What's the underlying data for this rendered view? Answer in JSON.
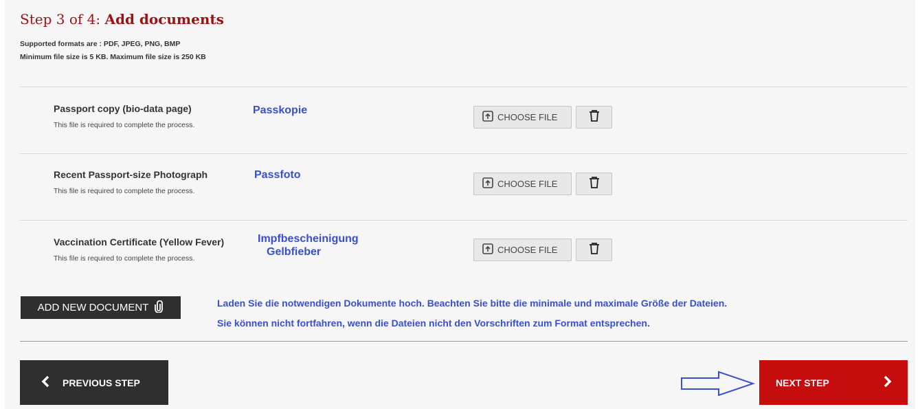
{
  "header": {
    "step_prefix": "Step 3 of 4: ",
    "step_title": "Add documents",
    "formats_note": "Supported formats are : PDF, JPEG, PNG, BMP",
    "size_note": "Minimum file size is 5 KB. Maximum file size is 250 KB"
  },
  "documents": [
    {
      "name": "Passport copy (bio-data page)",
      "note": "This file is required to complete the process.",
      "annotation_line1": "Passkopie",
      "annotation_line2": "",
      "choose_label": "CHOOSE FILE"
    },
    {
      "name": "Recent Passport-size Photograph",
      "note": "This file is required to complete the process.",
      "annotation_line1": "Passfoto",
      "annotation_line2": "",
      "choose_label": "CHOOSE FILE"
    },
    {
      "name": "Vaccination Certificate (Yellow Fever)",
      "note": "This file is required to complete the process.",
      "annotation_line1": "Impfbescheinigung",
      "annotation_line2": "Gelbfieber",
      "choose_label": "CHOOSE FILE"
    }
  ],
  "add_document_label": "ADD NEW DOCUMENT",
  "info": {
    "line1": "Laden Sie die notwendigen Dokumente hoch. Beachten Sie bitte die minimale und maximale Größe der Dateien.",
    "line2": "Sie können nicht fortfahren, wenn die Dateien nicht den Vorschriften zum Format entsprechen."
  },
  "nav": {
    "previous_label": "PREVIOUS STEP",
    "next_label": "NEXT STEP"
  },
  "icons": {
    "upload": "upload-icon",
    "trash": "trash-icon",
    "paperclip": "paperclip-icon",
    "chevron_left": "chevron-left-icon",
    "chevron_right": "chevron-right-icon",
    "annotation_arrow": "arrow-right-icon"
  },
  "colors": {
    "title": "#9b1414",
    "annotation": "#3a4fd0",
    "next_button": "#c50d0d",
    "dark_button": "#2f2f2f"
  }
}
